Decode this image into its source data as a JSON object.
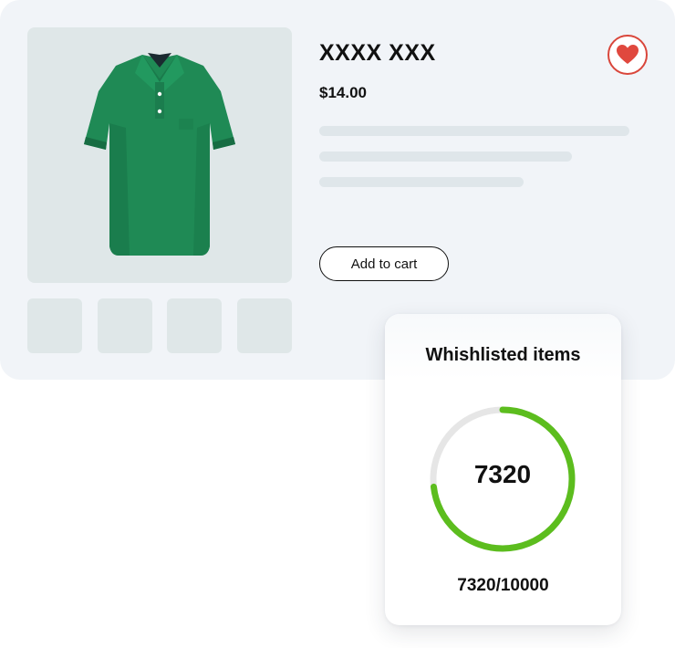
{
  "product": {
    "title": "XXXX XXX",
    "price": "$14.00",
    "add_to_cart_label": "Add to cart",
    "image": "green-polo-shirt",
    "thumbnail_count": 4
  },
  "wishlist": {
    "title": "Whishlisted items",
    "count": 7320,
    "count_label": "7320",
    "total": 10000,
    "fraction_label": "7320/10000",
    "progress": 0.732
  },
  "colors": {
    "card_background": "#f1f4f8",
    "image_background": "#dfe7e8",
    "heart": "#e0483e",
    "progress_fill": "#5cbd1e",
    "progress_track": "#e6e6e6",
    "shirt": "#1f8a55"
  },
  "icons": {
    "wishlist": "heart-icon"
  }
}
